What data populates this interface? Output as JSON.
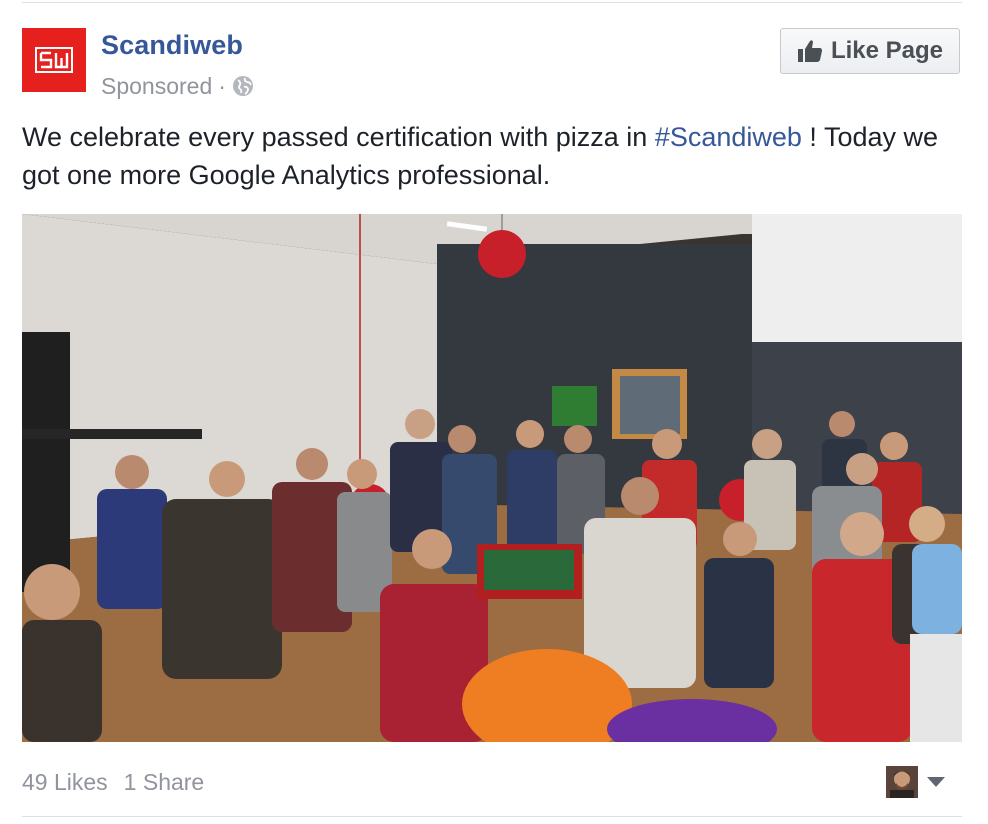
{
  "post": {
    "page_name": "Scandiweb",
    "logo_icon": "scandiweb-logo-icon",
    "brand_color": "#e5201d",
    "link_color": "#365899",
    "sponsored_label": "Sponsored",
    "separator": "·",
    "audience_icon": "globe-icon",
    "like_page_label": "Like Page",
    "like_icon": "thumbs-up-icon",
    "text_before_hashtag": "We celebrate every passed certification with pizza in ",
    "hashtag": "#Scandiweb",
    "text_after_hashtag": " ! Today we got one more Google Analytics professional.",
    "photo_icon": "office-pizza-party-photo",
    "likes_label": "49 Likes",
    "shares_label": "1 Share",
    "viewer_icon": "viewer-avatar-icon",
    "menu_icon": "caret-down-icon"
  }
}
